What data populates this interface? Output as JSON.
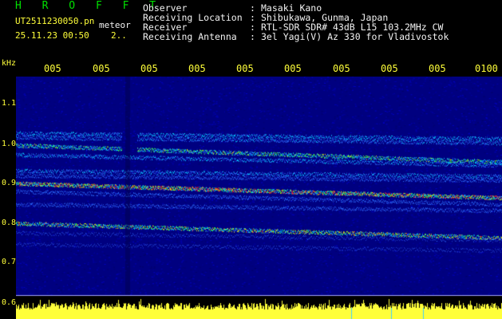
{
  "header": {
    "brand": "H R O F F T",
    "file_name": "UT2511230050.pn",
    "tag": "meteor",
    "timestamp": "25.11.23 00:50",
    "counter": "2.."
  },
  "meta": [
    {
      "key": "Observer",
      "value": "Masaki Kano"
    },
    {
      "key": "Receiving Location",
      "value": "Shibukawa, Gunma, Japan"
    },
    {
      "key": "Receiver",
      "value": "RTL-SDR SDR# 43dB L15 103.2MHz CW"
    },
    {
      "key": "Receiving Antenna",
      "value": "3el Yagi(V) Az 330 for Vladivostok"
    }
  ],
  "separator": ":",
  "axis": {
    "y_unit": "kHz",
    "y_ticks": [
      "1.1",
      "1.0",
      "0.9",
      "0.8",
      "0.7",
      "0.6"
    ],
    "x_ticks": [
      "005",
      "005",
      "005",
      "005",
      "005",
      "005",
      "005",
      "005",
      "005",
      "0100"
    ]
  },
  "colors": {
    "text": "#00e000",
    "accent": "#ffff3a",
    "background": "#000000",
    "spectrogram_bg": "#000080",
    "signal_high": "#ff2020"
  }
}
